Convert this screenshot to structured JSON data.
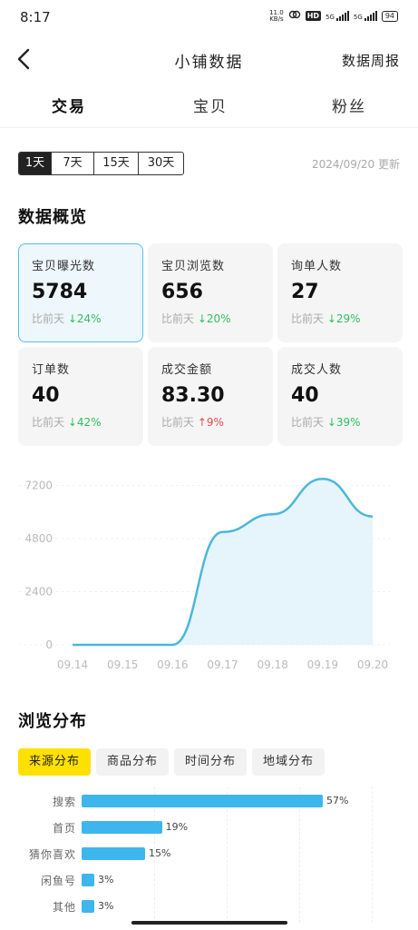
{
  "status_bar": {
    "time": "8:17",
    "net_speed_top": "11.0",
    "net_speed_bottom": "KB/s",
    "hd": "HD",
    "signal1_label": "5G",
    "signal2_label": "5G",
    "battery": "94"
  },
  "header": {
    "title": "小铺数据",
    "weekly_report": "数据周报"
  },
  "tabs": [
    "交易",
    "宝贝",
    "粉丝"
  ],
  "range": {
    "options": [
      "1天",
      "7天",
      "15天",
      "30天"
    ],
    "selected": "1天",
    "updated": "2024/09/20 更新"
  },
  "overview": {
    "title": "数据概览",
    "compare_prefix": "比前天",
    "cards": [
      {
        "label": "宝贝曝光数",
        "value": "5784",
        "change": "24%",
        "direction": "down"
      },
      {
        "label": "宝贝浏览数",
        "value": "656",
        "change": "20%",
        "direction": "down"
      },
      {
        "label": "询单人数",
        "value": "27",
        "change": "29%",
        "direction": "down"
      },
      {
        "label": "订单数",
        "value": "40",
        "change": "42%",
        "direction": "down"
      },
      {
        "label": "成交金额",
        "value": "83.30",
        "change": "9%",
        "direction": "up"
      },
      {
        "label": "成交人数",
        "value": "40",
        "change": "39%",
        "direction": "down"
      }
    ],
    "arrow_down": "↓",
    "arrow_up": "↑"
  },
  "chart_data": {
    "type": "area",
    "x": [
      "09.14",
      "09.15",
      "09.16",
      "09.17",
      "09.18",
      "09.19",
      "09.20"
    ],
    "values": [
      0,
      0,
      0,
      5100,
      5900,
      7500,
      5800
    ],
    "yticks": [
      0,
      2400,
      4800,
      7200
    ],
    "ylim": [
      0,
      7800
    ],
    "color": "#4bb6dc",
    "fill": "#e6f4fb"
  },
  "browse": {
    "title": "浏览分布",
    "filters": [
      "来源分布",
      "商品分布",
      "时间分布",
      "地域分布"
    ],
    "active_filter": "来源分布",
    "bars": [
      {
        "label": "搜索",
        "pct": "57%",
        "value": 57
      },
      {
        "label": "首页",
        "pct": "19%",
        "value": 19
      },
      {
        "label": "猜你喜欢",
        "pct": "15%",
        "value": 15
      },
      {
        "label": "闲鱼号",
        "pct": "3%",
        "value": 3
      },
      {
        "label": "其他",
        "pct": "3%",
        "value": 3
      }
    ]
  },
  "colors": {
    "accent_yellow": "#ffe000",
    "bar_blue": "#3db6ee",
    "down_green": "#2fbf5e",
    "up_red": "#ef4a4a"
  }
}
